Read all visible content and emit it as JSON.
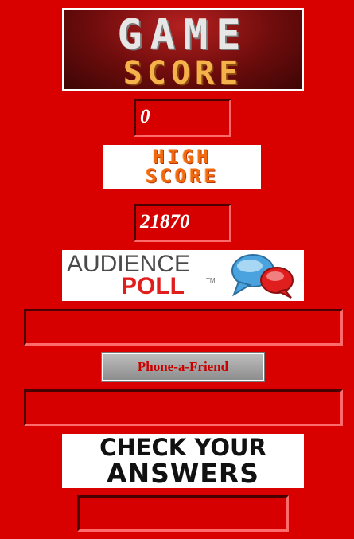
{
  "logos": {
    "game_score": {
      "line1": "GAME",
      "line2": "SCORE"
    },
    "high_score": {
      "line1": "HIGH",
      "line2": "SCORE"
    },
    "audience_poll": {
      "word1": "AUDIENCE",
      "word2": "POLL",
      "tm": "TM"
    }
  },
  "scores": {
    "game_score": "0",
    "high_score": "21870"
  },
  "buttons": {
    "phone_a_friend": "Phone-a-Friend",
    "check_answers_line1": "CHECK YOUR",
    "check_answers_line2": "ANSWERS"
  },
  "fields": {
    "audience_poll_result": "",
    "phone_friend_result": "",
    "check_answers_result": ""
  },
  "colors": {
    "background": "#d90000",
    "poll_red": "#e01e1e",
    "bubble_blue": "#4aa3df",
    "button_text": "#c80000"
  }
}
